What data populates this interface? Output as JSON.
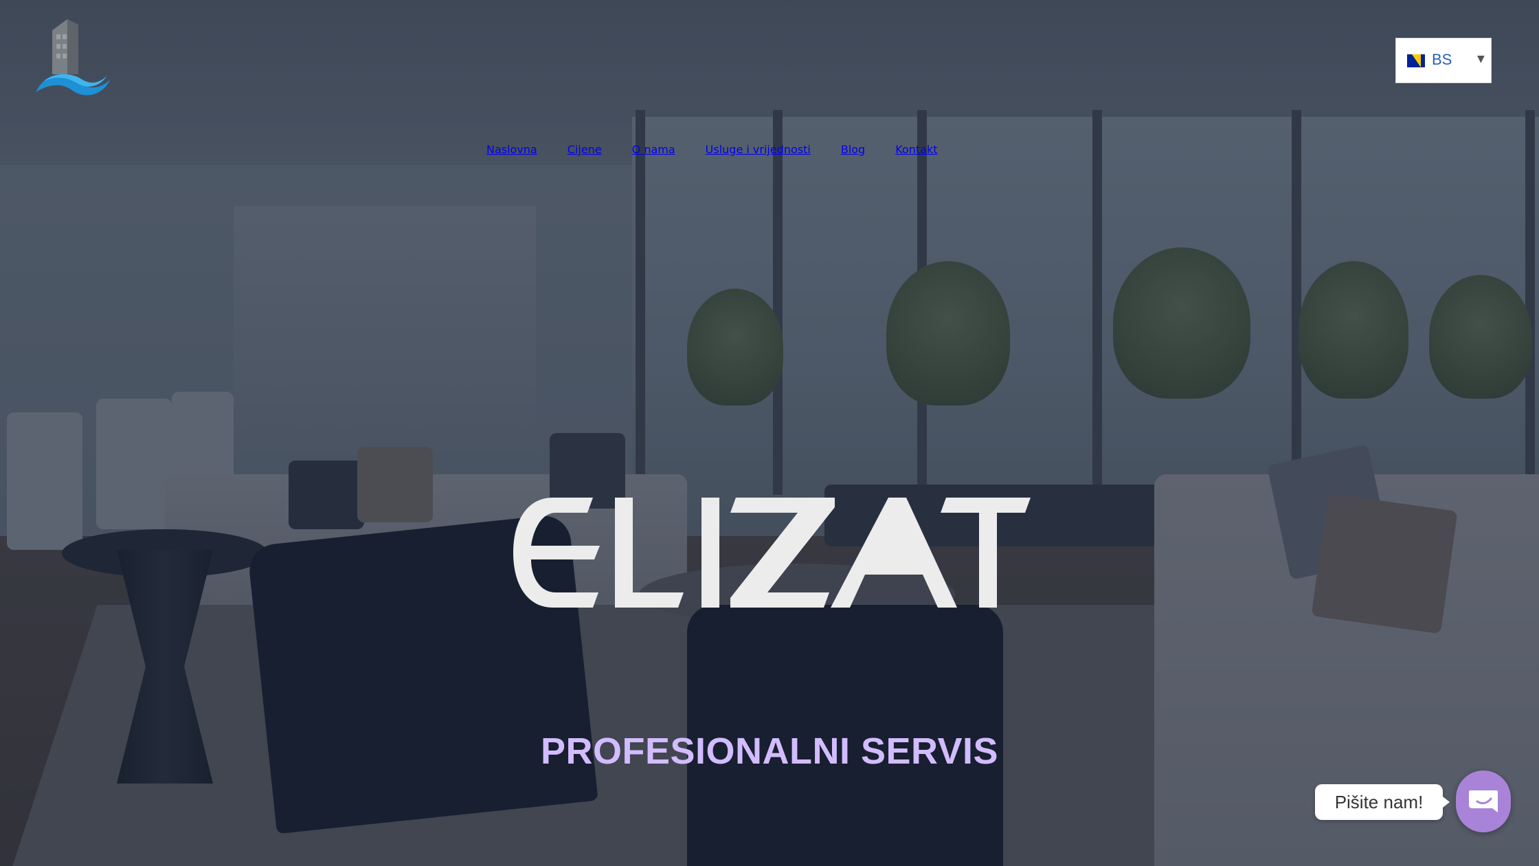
{
  "header": {
    "logo_icon": "building-wave-logo-icon",
    "language": {
      "code": "BS",
      "flag_icon": "bosnia-flag-icon",
      "caret_icon": "chevron-down-icon"
    }
  },
  "nav": {
    "items": [
      {
        "label": "Naslovna"
      },
      {
        "label": "Cijene"
      },
      {
        "label": "O nama"
      },
      {
        "label": "Usluge i vrijednosti"
      },
      {
        "label": "Blog"
      },
      {
        "label": "Kontakt"
      }
    ]
  },
  "hero": {
    "brand": "ELIZAT",
    "tagline": "PROFESIONALNI SERVIS"
  },
  "chat": {
    "prompt": "Pišite nam!",
    "icon": "chat-icon"
  },
  "colors": {
    "nav_text": "#d6c3ff",
    "tagline": "#d2bcff",
    "chat_button": "#a983d8",
    "brand_text": "#ececec"
  }
}
